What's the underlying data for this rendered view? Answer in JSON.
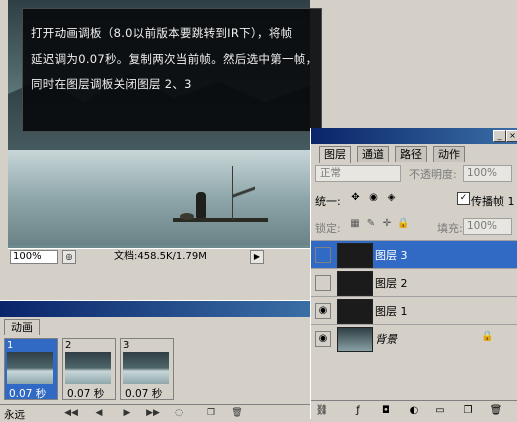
{
  "note": {
    "lines": [
      "打开动画调板（8.0以前版本要跳转到IR下），将帧",
      "延迟调为0.07秒。复制两次当前帧。然后选中第一帧，",
      "同时在图层调板关闭图层 2、3"
    ]
  },
  "document": {
    "zoom": "100%",
    "doc_info": "文档:458.5K/1.79M"
  },
  "layers_panel": {
    "tabs": [
      "图层",
      "通道",
      "路径",
      "动作"
    ],
    "blend_mode": "正常",
    "opacity_label": "不透明度:",
    "opacity_value": "100%",
    "unify_label": "统一:",
    "propagate_label": "传播帧 1",
    "lock_label": "锁定:",
    "fill_label": "填充:",
    "fill_value": "100%",
    "layers": [
      {
        "name": "图层 3",
        "selected": true,
        "visible": false
      },
      {
        "name": "图层 2",
        "selected": false,
        "visible": false
      },
      {
        "name": "图层 1",
        "selected": false,
        "visible": true
      },
      {
        "name": "背景",
        "selected": false,
        "visible": true,
        "locked": true
      }
    ]
  },
  "animation_panel": {
    "tab": "动画",
    "frames": [
      {
        "number": "1",
        "delay": "0.07 秒"
      },
      {
        "number": "2",
        "delay": "0.07 秒"
      },
      {
        "number": "3",
        "delay": "0.07 秒"
      }
    ],
    "loop": "永远"
  },
  "colors": {
    "selection": "#316ac5",
    "panel": "#d4d0c8",
    "titlebar": "#0a246a"
  }
}
